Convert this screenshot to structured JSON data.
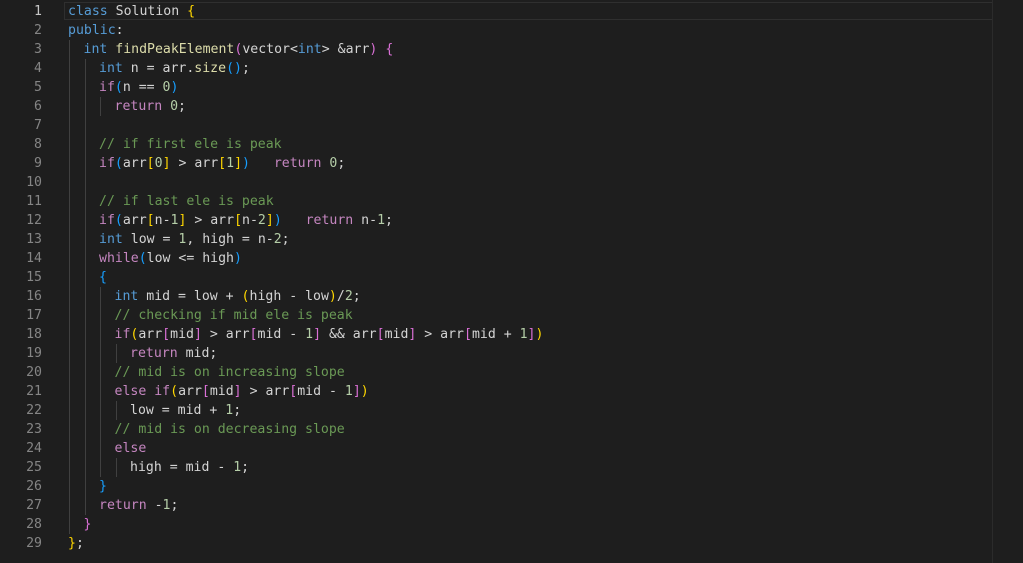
{
  "editor": {
    "language": "cpp",
    "active_line": 1,
    "colors": {
      "background": "#1e1e1e",
      "keyword": "#569cd6",
      "control": "#c586c0",
      "function": "#dcdcaa",
      "variable": "#9cdcfe",
      "number": "#b5cea8",
      "comment": "#6a9955",
      "bracket_gold": "#ffd700",
      "bracket_orchid": "#da70d6",
      "bracket_blue": "#179fff"
    },
    "lines": [
      {
        "n": "1",
        "indent": 0,
        "tokens": [
          [
            "kw",
            "class"
          ],
          [
            "plain",
            " Solution "
          ],
          [
            "br1",
            "{"
          ]
        ]
      },
      {
        "n": "2",
        "indent": 0,
        "tokens": [
          [
            "kw",
            "public"
          ],
          [
            "plain",
            ":"
          ]
        ]
      },
      {
        "n": "3",
        "indent": 1,
        "tokens": [
          [
            "kw",
            "int"
          ],
          [
            "plain",
            " "
          ],
          [
            "fn",
            "findPeakElement"
          ],
          [
            "br2",
            "("
          ],
          [
            "plain",
            "vector"
          ],
          [
            "plain",
            "<"
          ],
          [
            "kw",
            "int"
          ],
          [
            "plain",
            "> &"
          ],
          [
            "plain",
            "arr"
          ],
          [
            "br2",
            ")"
          ],
          [
            "plain",
            " "
          ],
          [
            "br2",
            "{"
          ]
        ]
      },
      {
        "n": "4",
        "indent": 2,
        "tokens": [
          [
            "kw",
            "int"
          ],
          [
            "plain",
            " n = arr."
          ],
          [
            "fn",
            "size"
          ],
          [
            "br3",
            "()"
          ],
          [
            "plain",
            ";"
          ]
        ]
      },
      {
        "n": "5",
        "indent": 2,
        "tokens": [
          [
            "ctl",
            "if"
          ],
          [
            "br3",
            "("
          ],
          [
            "plain",
            "n == "
          ],
          [
            "num",
            "0"
          ],
          [
            "br3",
            ")"
          ]
        ]
      },
      {
        "n": "6",
        "indent": 3,
        "tokens": [
          [
            "ctl",
            "return"
          ],
          [
            "plain",
            " "
          ],
          [
            "num",
            "0"
          ],
          [
            "plain",
            ";"
          ]
        ]
      },
      {
        "n": "7",
        "indent": 2,
        "tokens": []
      },
      {
        "n": "8",
        "indent": 2,
        "tokens": [
          [
            "cmt",
            "// if first ele is peak"
          ]
        ]
      },
      {
        "n": "9",
        "indent": 2,
        "tokens": [
          [
            "ctl",
            "if"
          ],
          [
            "br3",
            "("
          ],
          [
            "plain",
            "arr"
          ],
          [
            "br1",
            "["
          ],
          [
            "num",
            "0"
          ],
          [
            "br1",
            "]"
          ],
          [
            "plain",
            " > arr"
          ],
          [
            "br1",
            "["
          ],
          [
            "num",
            "1"
          ],
          [
            "br1",
            "]"
          ],
          [
            "br3",
            ")"
          ],
          [
            "plain",
            "   "
          ],
          [
            "ctl",
            "return"
          ],
          [
            "plain",
            " "
          ],
          [
            "num",
            "0"
          ],
          [
            "plain",
            ";"
          ]
        ]
      },
      {
        "n": "10",
        "indent": 2,
        "tokens": []
      },
      {
        "n": "11",
        "indent": 2,
        "tokens": [
          [
            "cmt",
            "// if last ele is peak"
          ]
        ]
      },
      {
        "n": "12",
        "indent": 2,
        "tokens": [
          [
            "ctl",
            "if"
          ],
          [
            "br3",
            "("
          ],
          [
            "plain",
            "arr"
          ],
          [
            "br1",
            "["
          ],
          [
            "plain",
            "n-"
          ],
          [
            "num",
            "1"
          ],
          [
            "br1",
            "]"
          ],
          [
            "plain",
            " > arr"
          ],
          [
            "br1",
            "["
          ],
          [
            "plain",
            "n-"
          ],
          [
            "num",
            "2"
          ],
          [
            "br1",
            "]"
          ],
          [
            "br3",
            ")"
          ],
          [
            "plain",
            "   "
          ],
          [
            "ctl",
            "return"
          ],
          [
            "plain",
            " n-"
          ],
          [
            "num",
            "1"
          ],
          [
            "plain",
            ";"
          ]
        ]
      },
      {
        "n": "13",
        "indent": 2,
        "tokens": [
          [
            "kw",
            "int"
          ],
          [
            "plain",
            " low = "
          ],
          [
            "num",
            "1"
          ],
          [
            "plain",
            ", high = n-"
          ],
          [
            "num",
            "2"
          ],
          [
            "plain",
            ";"
          ]
        ]
      },
      {
        "n": "14",
        "indent": 2,
        "tokens": [
          [
            "ctl",
            "while"
          ],
          [
            "br3",
            "("
          ],
          [
            "plain",
            "low <= high"
          ],
          [
            "br3",
            ")"
          ]
        ]
      },
      {
        "n": "15",
        "indent": 2,
        "tokens": [
          [
            "br3",
            "{"
          ]
        ]
      },
      {
        "n": "16",
        "indent": 3,
        "tokens": [
          [
            "kw",
            "int"
          ],
          [
            "plain",
            " mid = low + "
          ],
          [
            "br1",
            "("
          ],
          [
            "plain",
            "high - low"
          ],
          [
            "br1",
            ")"
          ],
          [
            "plain",
            "/"
          ],
          [
            "num",
            "2"
          ],
          [
            "plain",
            ";"
          ]
        ]
      },
      {
        "n": "17",
        "indent": 3,
        "tokens": [
          [
            "cmt",
            "// checking if mid ele is peak"
          ]
        ]
      },
      {
        "n": "18",
        "indent": 3,
        "tokens": [
          [
            "ctl",
            "if"
          ],
          [
            "br1",
            "("
          ],
          [
            "plain",
            "arr"
          ],
          [
            "br2",
            "["
          ],
          [
            "plain",
            "mid"
          ],
          [
            "br2",
            "]"
          ],
          [
            "plain",
            " > arr"
          ],
          [
            "br2",
            "["
          ],
          [
            "plain",
            "mid - "
          ],
          [
            "num",
            "1"
          ],
          [
            "br2",
            "]"
          ],
          [
            "plain",
            " && arr"
          ],
          [
            "br2",
            "["
          ],
          [
            "plain",
            "mid"
          ],
          [
            "br2",
            "]"
          ],
          [
            "plain",
            " > arr"
          ],
          [
            "br2",
            "["
          ],
          [
            "plain",
            "mid + "
          ],
          [
            "num",
            "1"
          ],
          [
            "br2",
            "]"
          ],
          [
            "br1",
            ")"
          ]
        ]
      },
      {
        "n": "19",
        "indent": 4,
        "tokens": [
          [
            "ctl",
            "return"
          ],
          [
            "plain",
            " mid;"
          ]
        ]
      },
      {
        "n": "20",
        "indent": 3,
        "tokens": [
          [
            "cmt",
            "// mid is on increasing slope"
          ]
        ]
      },
      {
        "n": "21",
        "indent": 3,
        "tokens": [
          [
            "ctl",
            "else"
          ],
          [
            "plain",
            " "
          ],
          [
            "ctl",
            "if"
          ],
          [
            "br1",
            "("
          ],
          [
            "plain",
            "arr"
          ],
          [
            "br2",
            "["
          ],
          [
            "plain",
            "mid"
          ],
          [
            "br2",
            "]"
          ],
          [
            "plain",
            " > arr"
          ],
          [
            "br2",
            "["
          ],
          [
            "plain",
            "mid - "
          ],
          [
            "num",
            "1"
          ],
          [
            "br2",
            "]"
          ],
          [
            "br1",
            ")"
          ]
        ]
      },
      {
        "n": "22",
        "indent": 4,
        "tokens": [
          [
            "plain",
            "low = mid + "
          ],
          [
            "num",
            "1"
          ],
          [
            "plain",
            ";"
          ]
        ]
      },
      {
        "n": "23",
        "indent": 3,
        "tokens": [
          [
            "cmt",
            "// mid is on decreasing slope"
          ]
        ]
      },
      {
        "n": "24",
        "indent": 3,
        "tokens": [
          [
            "ctl",
            "else"
          ]
        ]
      },
      {
        "n": "25",
        "indent": 4,
        "tokens": [
          [
            "plain",
            "high = mid - "
          ],
          [
            "num",
            "1"
          ],
          [
            "plain",
            ";"
          ]
        ]
      },
      {
        "n": "26",
        "indent": 2,
        "tokens": [
          [
            "br3",
            "}"
          ]
        ]
      },
      {
        "n": "27",
        "indent": 2,
        "tokens": [
          [
            "ctl",
            "return"
          ],
          [
            "plain",
            " -"
          ],
          [
            "num",
            "1"
          ],
          [
            "plain",
            ";"
          ]
        ]
      },
      {
        "n": "28",
        "indent": 1,
        "tokens": [
          [
            "br2",
            "}"
          ]
        ]
      },
      {
        "n": "29",
        "indent": 0,
        "tokens": [
          [
            "br1",
            "}"
          ],
          [
            "plain",
            ";"
          ]
        ]
      }
    ]
  }
}
